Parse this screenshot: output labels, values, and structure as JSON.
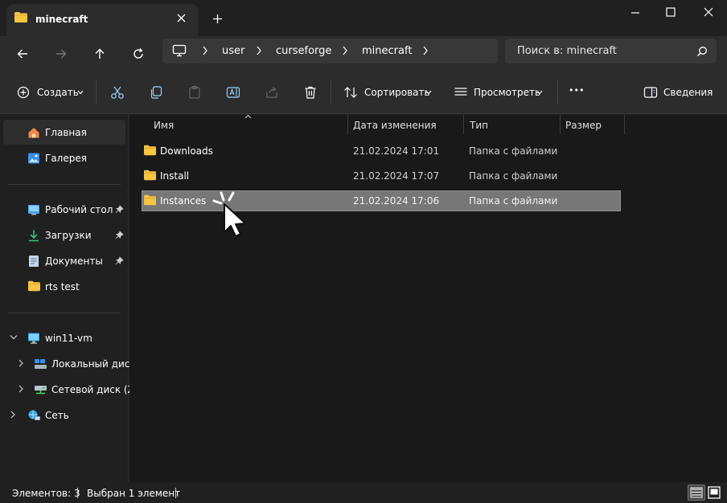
{
  "window": {
    "tab_title": "minecraft",
    "new_tab_symbol": "+"
  },
  "address": {
    "crumbs": [
      "user",
      "curseforge",
      "minecraft"
    ],
    "search_placeholder": "Поиск в: minecraft"
  },
  "toolbar": {
    "create_label": "Создать",
    "sort_label": "Сортировать",
    "view_label": "Просмотреть",
    "more_label": "•••",
    "details_label": "Сведения"
  },
  "sidebar": {
    "items": [
      {
        "label": "Главная",
        "icon": "home-icon"
      },
      {
        "label": "Галерея",
        "icon": "gallery-icon"
      },
      {
        "label": "Рабочий стол",
        "icon": "desktop-icon",
        "pinned": true
      },
      {
        "label": "Загрузки",
        "icon": "download-icon",
        "pinned": true
      },
      {
        "label": "Документы",
        "icon": "documents-icon",
        "pinned": true
      },
      {
        "label": "rts test",
        "icon": "folder-icon"
      },
      {
        "label": "win11-vm",
        "icon": "computer-icon"
      },
      {
        "label": "Локальный диск",
        "icon": "local-disk-icon"
      },
      {
        "label": "Сетевой диск (Z:)",
        "icon": "network-drive-icon"
      },
      {
        "label": "Сеть",
        "icon": "network-icon"
      }
    ]
  },
  "columns": [
    "Имя",
    "Дата изменения",
    "Тип",
    "Размер"
  ],
  "rows": [
    {
      "name": "Downloads",
      "date": "21.02.2024 17:01",
      "type": "Папка с файлами",
      "selected": false
    },
    {
      "name": "Install",
      "date": "21.02.2024 17:07",
      "type": "Папка с файлами",
      "selected": false
    },
    {
      "name": "Instances",
      "date": "21.02.2024 17:06",
      "type": "Папка с файлами",
      "selected": true
    }
  ],
  "status": {
    "items_count": "Элементов: 3",
    "selected_count": "Выбран 1 элемент"
  },
  "colors": {
    "background": "#202020",
    "content": "#191919",
    "selection": "#777777",
    "folder": "#f5c544"
  }
}
